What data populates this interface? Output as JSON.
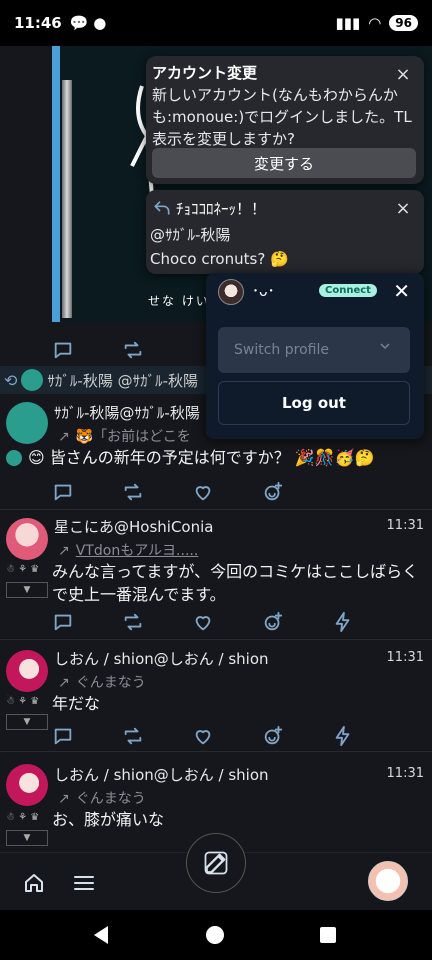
{
  "statusbar": {
    "time": "11:46",
    "battery": "96"
  },
  "media": {
    "caption": "せな けい"
  },
  "renote": {
    "text": "ｻｶﾞﾙ-秋陽 @ｻｶﾞﾙ-秋陽"
  },
  "posts": [
    {
      "name": "ｻｶﾞﾙ-秋陽@ｻｶﾞﾙ-秋陽",
      "reply": "🐯「お前はどこを",
      "body": "😊 皆さんの新年の予定は何ですか？ 🎉🎊🥳🤔"
    },
    {
      "name": "星こにあ@HoshiConia",
      "time": "11:31",
      "reply": "VTdonもアルヨ.....",
      "body": "みんな言ってますが、今回のコミケはここしばらくで史上一番混んでます。",
      "badge": "▼"
    },
    {
      "name": "しおん / shion@しおん / shion",
      "time": "11:31",
      "reply": "ぐんまなう",
      "body": "年だな",
      "badge": "▼"
    },
    {
      "name": "しおん / shion@しおん / shion",
      "time": "11:31",
      "reply": "ぐんまなう",
      "body": "お、膝が痛いな",
      "badge": "▼"
    }
  ],
  "notice_account": {
    "title": "アカウント変更",
    "message": "新しいアカウント(なんもわからんかも:monoue:)でログインしました。TL表示を変更しますか?",
    "button": "変更する",
    "close": "×"
  },
  "notice_mention": {
    "title": "ﾁｮｺｺﾛﾈｰｯ！！",
    "line1": "@ｻｶﾞﾙ-秋陽",
    "line2": "Choco cronuts? 🤔",
    "close": "×"
  },
  "account_panel": {
    "name": "･ᴗ･",
    "badge": "Connect",
    "close": "✕",
    "switch_placeholder": "Switch profile",
    "logout": "Log out"
  },
  "colors": {
    "accent": "#7fa6c8",
    "connect": "#a8f0e0",
    "panel": "#0f1a2a"
  }
}
